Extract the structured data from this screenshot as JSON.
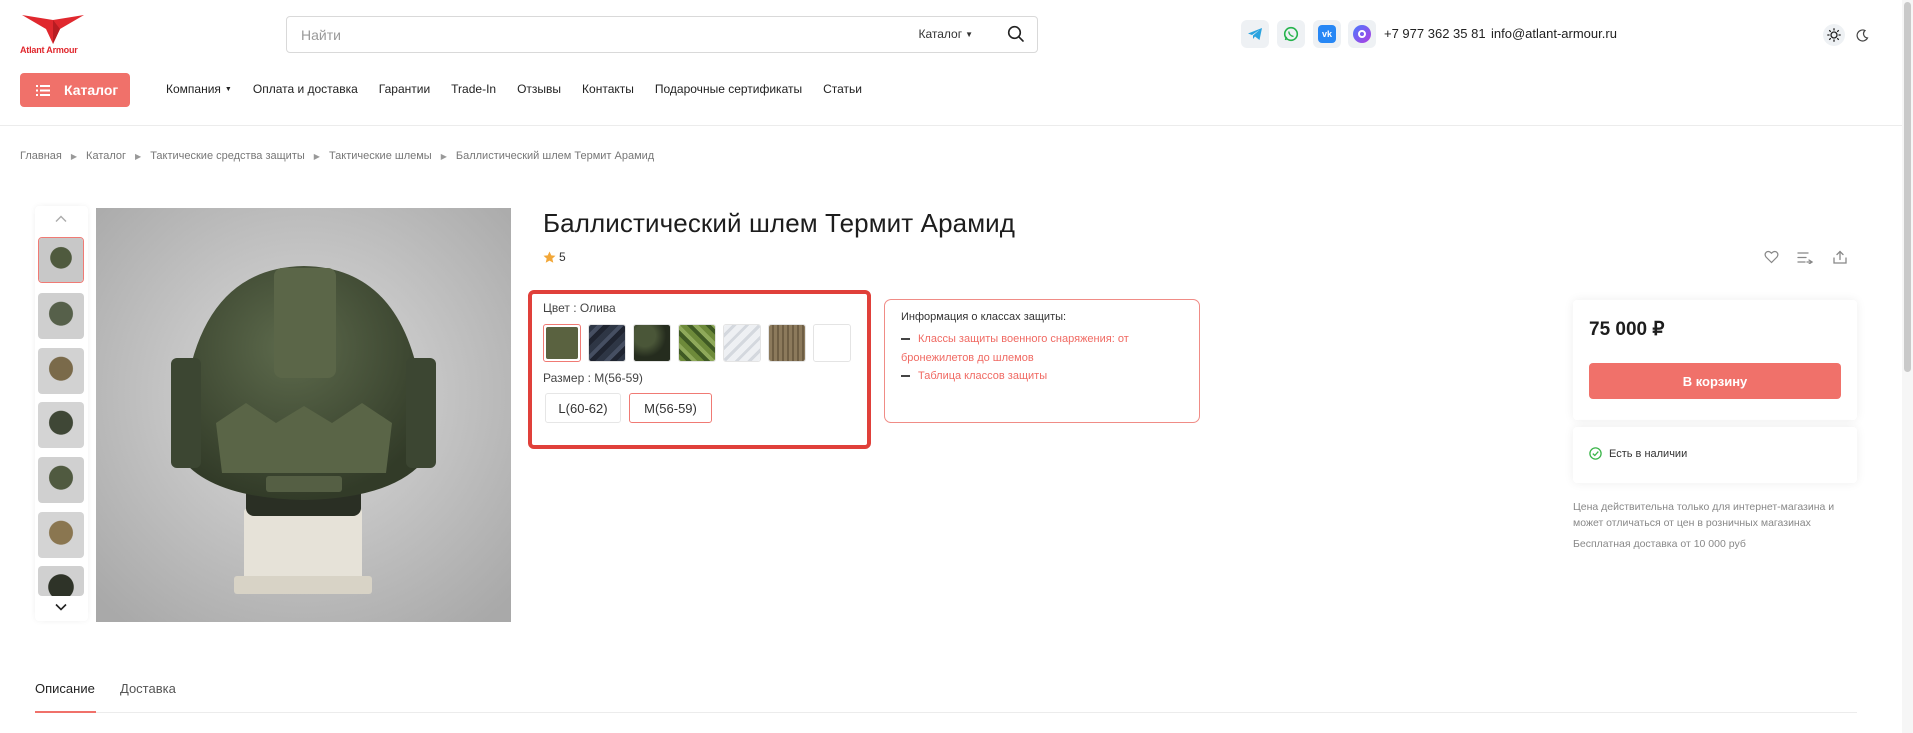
{
  "header": {
    "logo_text": "Atlant Armour",
    "search": {
      "placeholder": "Найти",
      "category": "Каталог"
    },
    "social": [
      "telegram-icon",
      "whatsapp-icon",
      "vk-icon",
      "max-messenger-icon"
    ],
    "phone": "+7 977 362 35 81",
    "email": "info@atlant-armour.ru",
    "catalog_button": "Каталог",
    "nav": [
      {
        "label": "Компания",
        "has_dropdown": true
      },
      {
        "label": "Оплата и доставка"
      },
      {
        "label": "Гарантии"
      },
      {
        "label": "Trade-In"
      },
      {
        "label": "Отзывы"
      },
      {
        "label": "Контакты"
      },
      {
        "label": "Подарочные сертификаты"
      },
      {
        "label": "Статьи"
      }
    ]
  },
  "breadcrumb": [
    "Главная",
    "Каталог",
    "Тактические средства защиты",
    "Тактические шлемы",
    "Баллистический шлем Термит Арамид"
  ],
  "product": {
    "title": "Баллистический шлем Термит Арамид",
    "rating": "5",
    "color_label": "Цвет : Олива",
    "colors": [
      {
        "name": "olive",
        "color": "#5a6240",
        "selected": true
      },
      {
        "name": "dark-camo",
        "color": "#2e3645"
      },
      {
        "name": "dark-green-camo",
        "color": "#2f3826"
      },
      {
        "name": "green-pixel-camo",
        "color": "#6d8a3a"
      },
      {
        "name": "white-camo",
        "color": "#e8eaee"
      },
      {
        "name": "coyote-stripe",
        "color": "#8c7a5c"
      },
      {
        "name": "white",
        "color": "#ffffff"
      }
    ],
    "size_label": "Размер : M(56-59)",
    "sizes": [
      {
        "label": "L(60-62)",
        "selected": false
      },
      {
        "label": "M(56-59)",
        "selected": true
      }
    ],
    "info": {
      "title": "Информация о классах защиты:",
      "link1_line1": "Классы защиты военного снаряжения: от",
      "link1_line2": "бронежилетов до шлемов",
      "link2": "Таблица классов защиты"
    },
    "price": "75 000 ₽",
    "cart_button": "В корзину",
    "stock": "Есть в наличии",
    "price_note": "Цена действительна только для интернет-магазина и может отличаться от цен в розничных магазинах",
    "delivery_note": "Бесплатная доставка от 10 000 руб"
  },
  "tabs": [
    {
      "label": "Описание",
      "active": true
    },
    {
      "label": "Доставка",
      "active": false
    }
  ],
  "colors": {
    "accent": "#f0716a",
    "brand_red": "#e0282e",
    "highlight_box": "#e0403a"
  }
}
